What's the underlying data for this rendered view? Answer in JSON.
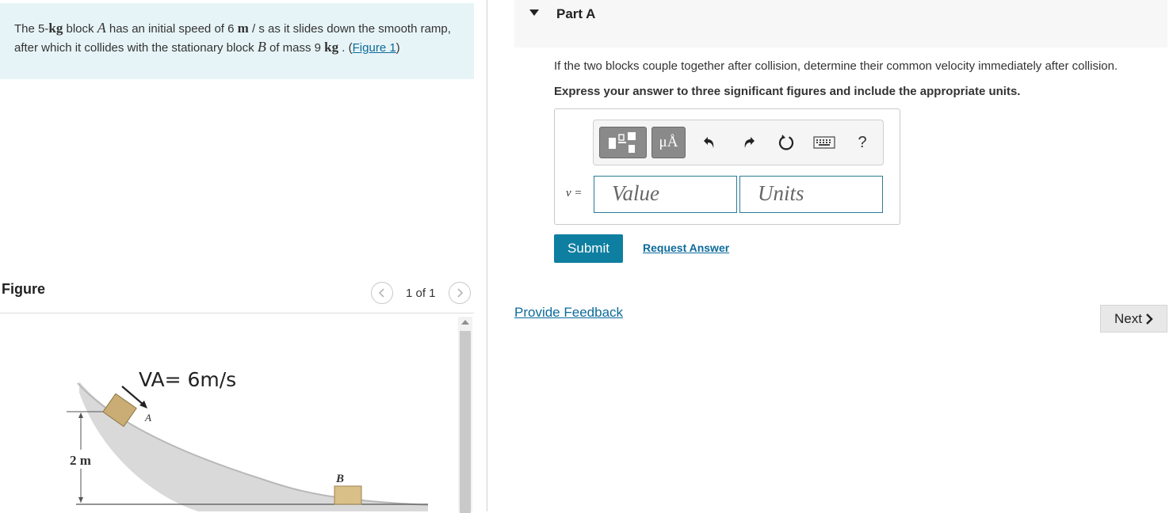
{
  "problem": {
    "t1": "The 5-",
    "u_kg": "kg",
    "t2": " block ",
    "var_a": "A",
    "t3": " has an initial speed of 6 ",
    "u_m": "m",
    "slash": " / ",
    "u_s": "s",
    "t4": " as it slides down the smooth ramp, after which it collides with the stationary block ",
    "var_b": "B",
    "t5": " of mass 9 ",
    "u_kg2": "kg",
    "t6": " . (",
    "figure_link": "Figure 1",
    "t7": ")"
  },
  "figure": {
    "title": "Figure",
    "counter": "1 of 1",
    "prev_icon": "chevron-left-icon",
    "next_icon": "chevron-right-icon",
    "velocity_label": "VA= 6m/s",
    "block_a_label": "A",
    "block_b_label": "B",
    "height_label": "2 m"
  },
  "part": {
    "title": "Part A",
    "question": "If the two blocks couple together after collision, determine their common velocity immediately after collision.",
    "instruction": "Express your answer to three significant figures and include the appropriate units."
  },
  "toolbar": {
    "units_symbol": "μÅ",
    "help_label": "?",
    "icons": [
      "templates-icon",
      "units-icon",
      "undo-icon",
      "redo-icon",
      "reset-icon",
      "keyboard-icon",
      "help-icon"
    ]
  },
  "answer": {
    "variable_label": "v =",
    "value_placeholder": "Value",
    "units_placeholder": "Units"
  },
  "actions": {
    "submit": "Submit",
    "request_answer": "Request Answer",
    "provide_feedback": "Provide Feedback",
    "next": "Next"
  },
  "colors": {
    "problem_bg": "#e7f4f7",
    "submit_bg": "#0e7fa0",
    "link": "#0d6a9b",
    "field_border": "#2b7a95"
  }
}
